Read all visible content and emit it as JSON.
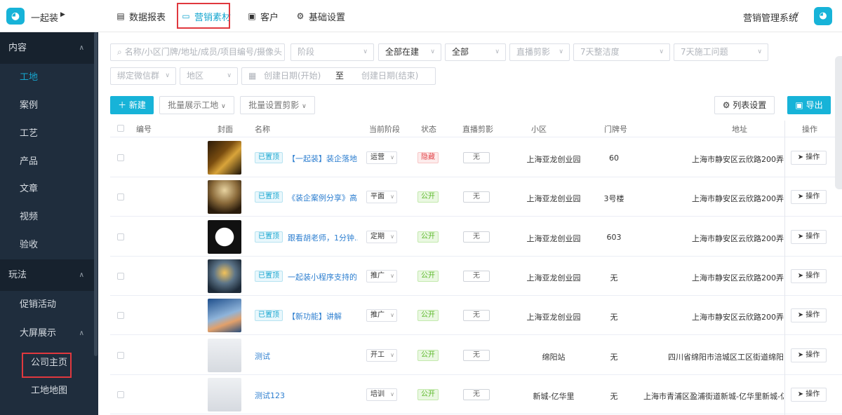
{
  "brand": {
    "name": "一起装"
  },
  "topnav": [
    {
      "label": "数据报表",
      "icon": "doc-icon"
    },
    {
      "label": "营销素材",
      "icon": "folder-icon"
    },
    {
      "label": "客户",
      "icon": "user-icon"
    },
    {
      "label": "基础设置",
      "icon": "gear-icon"
    }
  ],
  "system": {
    "label": "营销管理系统"
  },
  "sidebar": {
    "sections": [
      {
        "label": "内容",
        "items": [
          "工地",
          "案例",
          "工艺",
          "产品",
          "文章",
          "视频",
          "验收"
        ]
      },
      {
        "label": "玩法",
        "items": [
          "促销活动"
        ],
        "group": {
          "label": "大屏展示",
          "items": [
            "公司主页",
            "工地地图"
          ]
        }
      }
    ]
  },
  "filters": {
    "search_placeholder": "名称/小区门牌/地址/成员/项目编号/摄像头",
    "stage_placeholder": "阶段",
    "build_status": "全部在建",
    "all": "全部",
    "live_placeholder": "直播剪影",
    "tidy_placeholder": "7天整洁度",
    "issue_placeholder": "7天施工问题",
    "wechat_placeholder": "绑定微信群",
    "region_placeholder": "地区",
    "date_start": "创建日期(开始)",
    "date_to": "至",
    "date_end": "创建日期(结束)"
  },
  "toolbar": {
    "new_label": "新建",
    "batch_show": "批量展示工地",
    "batch_clip": "批量设置剪影",
    "column_settings": "列表设置",
    "export": "导出"
  },
  "table": {
    "headers": [
      "编号",
      "封面",
      "名称",
      "当前阶段",
      "状态",
      "直播剪影",
      "小区",
      "门牌号",
      "地址",
      "操作"
    ],
    "pinned_label": "已置顶",
    "clip_none": "无",
    "op_label": "操作",
    "rows": [
      {
        "pinned": true,
        "name": "【一起装】装企落地...",
        "stage": "运营",
        "status": "隐藏",
        "status_type": "hidden",
        "community": "上海亚龙创业园",
        "door": "60",
        "address": "上海市静安区云欣路200弄",
        "thumb": "poster"
      },
      {
        "pinned": true,
        "name": "《装企案例分享》高...",
        "stage": "平面",
        "status": "公开",
        "status_type": "public",
        "community": "上海亚龙创业园",
        "door": "3号楼",
        "address": "上海市静安区云欣路200弄",
        "thumb": "soldier"
      },
      {
        "pinned": true,
        "name": "跟看胡老师，1分钟...",
        "stage": "定期",
        "status": "公开",
        "status_type": "public",
        "community": "上海亚龙创业园",
        "door": "603",
        "address": "上海市静安区云欣路200弄",
        "thumb": "camera"
      },
      {
        "pinned": true,
        "name": "一起装小程序支持的...",
        "stage": "推广",
        "status": "公开",
        "status_type": "public",
        "community": "上海亚龙创业园",
        "door": "无",
        "address": "上海市静安区云欣路200弄",
        "thumb": "globe"
      },
      {
        "pinned": true,
        "name": "【新功能】讲解",
        "stage": "推广",
        "status": "公开",
        "status_type": "public",
        "community": "上海亚龙创业园",
        "door": "无",
        "address": "上海市静安区云欣路200弄",
        "thumb": "hands"
      },
      {
        "pinned": false,
        "name": "测试",
        "stage": "开工",
        "status": "公开",
        "status_type": "public",
        "community": "绵阳站",
        "door": "无",
        "address": "四川省绵阳市涪城区工区街道绵阳",
        "thumb": "drill"
      },
      {
        "pinned": false,
        "name": "测试123",
        "stage": "培训",
        "status": "公开",
        "status_type": "public",
        "community": "新城-亿华里",
        "door": "无",
        "address": "上海市青浦区盈浦街道新城-亿华里新城-亿",
        "thumb": "drill"
      }
    ]
  },
  "colors": {
    "accent": "#17b3d8",
    "sidebar": "#1f2d3d",
    "highlight": "#e0383e",
    "public": "#5cb82a",
    "hidden": "#e2484d"
  }
}
